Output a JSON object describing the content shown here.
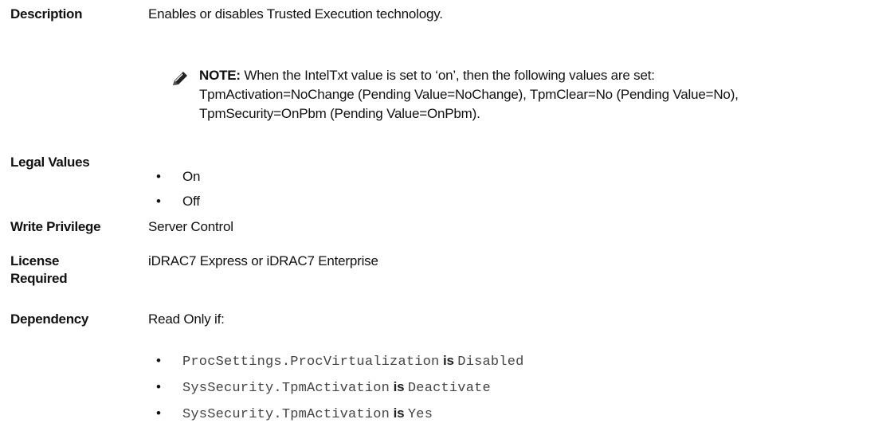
{
  "description": {
    "label": "Description",
    "text": "Enables or disables Trusted Execution technology.",
    "note": {
      "icon": "pencil-note-icon",
      "prefix": "NOTE:",
      "line1": "When the IntelTxt value is set to ‘on’, then the following values are set:",
      "line2": "TpmActivation=NoChange (Pending Value=NoChange), TpmClear=No (Pending Value=No),",
      "line3": "TpmSecurity=OnPbm (Pending Value=OnPbm)."
    }
  },
  "legal_values": {
    "label": "Legal Values",
    "items": [
      "On",
      "Off"
    ]
  },
  "write_privilege": {
    "label": "Write Privilege",
    "value": "Server Control"
  },
  "license_required": {
    "label_line1": "License",
    "label_line2": "Required",
    "value": "iDRAC7 Express or iDRAC7 Enterprise"
  },
  "dependency": {
    "label": "Dependency",
    "intro": "Read Only if:",
    "conditions": [
      {
        "attribute": "ProcSettings.ProcVirtualization",
        "connector": "is",
        "value": "Disabled"
      },
      {
        "attribute": "SysSecurity.TpmActivation",
        "connector": "is",
        "value": "Deactivate"
      },
      {
        "attribute": "SysSecurity.TpmActivation",
        "connector": "is",
        "value": "Yes"
      }
    ]
  }
}
